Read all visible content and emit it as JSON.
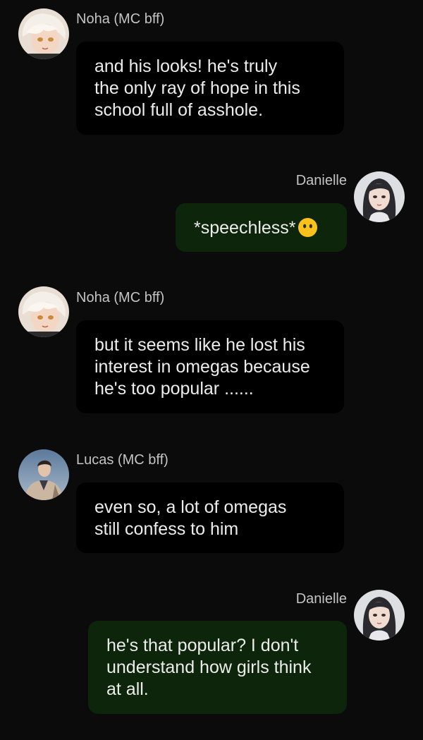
{
  "messages": [
    {
      "sender": "Noha (MC bff)",
      "avatar": "noha-avatar",
      "side": "left",
      "lines": [
        "and his looks! he's truly",
        "the only ray of hope in this",
        "school full of asshole."
      ]
    },
    {
      "sender": "Danielle",
      "avatar": "danielle-avatar",
      "side": "right",
      "lines": [
        "*speechless*"
      ],
      "emoji": "neutral-face-no-mouth-emoji"
    },
    {
      "sender": "Noha (MC bff)",
      "avatar": "noha-avatar",
      "side": "left",
      "lines": [
        "but it seems like he lost his",
        "interest in omegas because",
        "he's too popular ......"
      ]
    },
    {
      "sender": "Lucas (MC bff)",
      "avatar": "lucas-avatar",
      "side": "left",
      "lines": [
        "even so, a lot of omegas",
        "still confess to him"
      ]
    },
    {
      "sender": "Danielle",
      "avatar": "danielle-avatar",
      "side": "right",
      "lines": [
        "he's that popular? I don't",
        "understand how girls think",
        "at all."
      ]
    }
  ],
  "colors": {
    "background": "#0b0b0b",
    "incoming_bubble": "#000000",
    "outgoing_bubble": "#0d250b",
    "name_text": "#c4c4c4",
    "message_text": "#ececec"
  }
}
